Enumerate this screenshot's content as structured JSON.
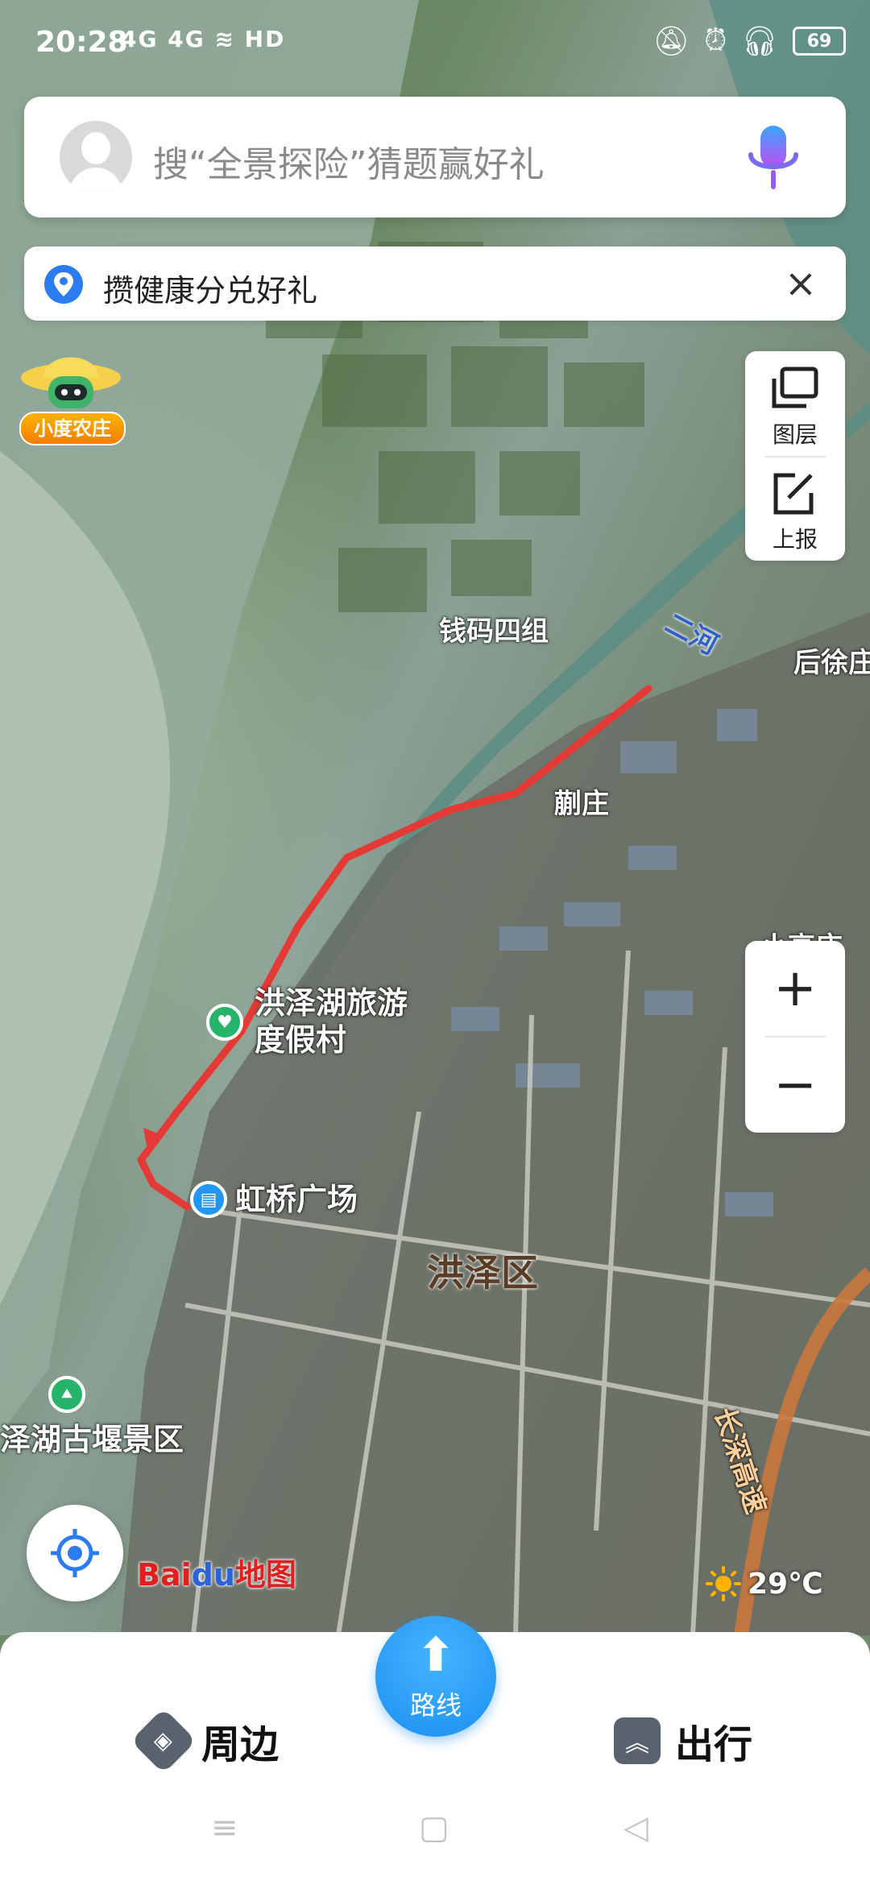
{
  "status_bar": {
    "time": "20:28",
    "network": "4G 4G",
    "hd": "HD",
    "battery": "69"
  },
  "search": {
    "placeholder": "搜“全景探险”猜题赢好礼"
  },
  "banner": {
    "text": "攒健康分兑好礼"
  },
  "farm": {
    "label": "小度农庄"
  },
  "map_tools": {
    "layers_label": "图层",
    "report_label": "上报"
  },
  "zoom": {
    "zoom_in": "+",
    "zoom_out": "−"
  },
  "map_labels": {
    "qianma": "钱码四组",
    "erhe": "二河",
    "houxu": "后徐庄",
    "kuaizhuang": "蒯庄",
    "resort_line1": "洪泽湖旅游",
    "resort_line2": "度假村",
    "hongqiao": "虹桥广场",
    "district": "洪泽区",
    "guyan": "泽湖古堰景区",
    "expressway": "长深高速",
    "xiaogao": "小高庄"
  },
  "logo": {
    "bai": "Bai",
    "du": "du",
    "ditu": "地图"
  },
  "weather": {
    "temp": "29℃"
  },
  "bottom_nav": {
    "nearby": "周边",
    "route": "路线",
    "travel": "出行"
  },
  "colors": {
    "accent": "#1c8ff0",
    "route_line": "#e53935",
    "water": "#8fa89a"
  }
}
